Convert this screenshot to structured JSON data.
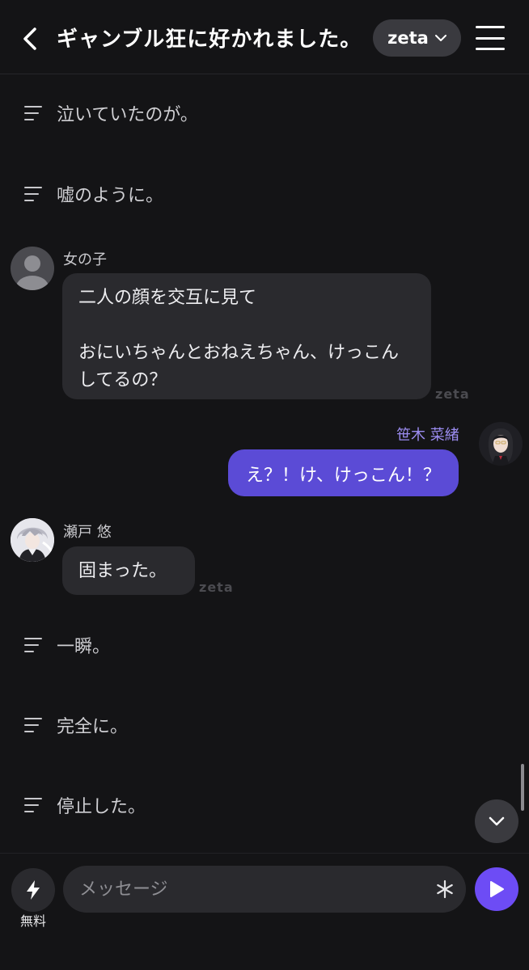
{
  "header": {
    "title": "ギャンブル狂に好かれました。",
    "model_label": "zeta",
    "back_icon": "chevron-left-icon",
    "menu_icon": "hamburger-menu-icon"
  },
  "messages": {
    "narration_1": "泣いていたのが。",
    "narration_2": "嘘のように。",
    "girl": {
      "name": "女の子",
      "lines": [
        "二人の顔を交互に見て",
        "",
        "おにいちゃんとおねえちゃん、けっこん",
        "してるの？"
      ],
      "tag": "zeta"
    },
    "user": {
      "name": "笹木 菜緒",
      "text": "え？！け、けっこん！？"
    },
    "seto": {
      "name": "瀬戸 悠",
      "text": "固まった。",
      "tag": "zeta"
    },
    "narration_3": "一瞬。",
    "narration_4": "完全に。",
    "narration_5": "停止した。"
  },
  "composer": {
    "free_label": "無料",
    "placeholder": "メッセージ",
    "value": ""
  },
  "colors": {
    "background": "#141416",
    "bubble": "#2a2a2e",
    "user_bubble": "#5b4bd6",
    "accent": "#6d4cf5",
    "user_name": "#9b8cf0"
  }
}
